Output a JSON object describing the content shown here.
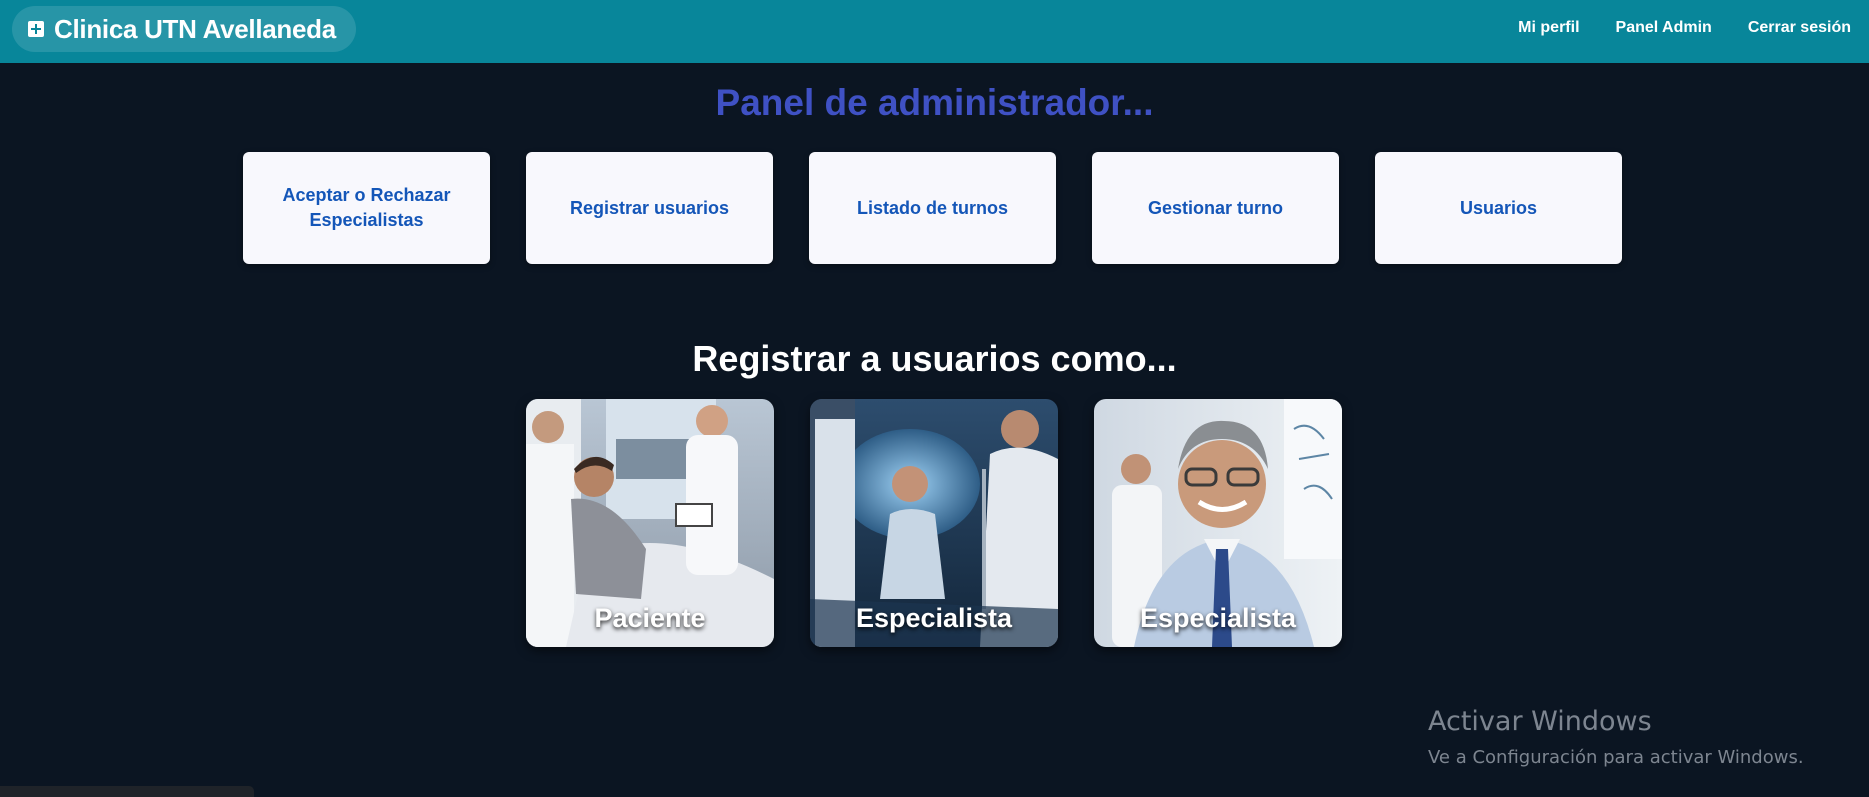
{
  "navbar": {
    "brand": "Clinica UTN Avellaneda",
    "brand_icon": "plus-square-icon",
    "links": [
      "Mi perfil",
      "Panel Admin",
      "Cerrar sesión"
    ]
  },
  "admin": {
    "title": "Panel de administrador...",
    "cards": [
      "Aceptar o Rechazar Especialistas",
      "Registrar usuarios",
      "Listado de turnos",
      "Gestionar turno",
      "Usuarios"
    ]
  },
  "register": {
    "title": "Registrar a usuarios como...",
    "tiles": [
      "Paciente",
      "Especialista",
      "Especialista"
    ]
  },
  "watermark": {
    "title": "Activar Windows",
    "subtitle": "Ve a Configuración para activar Windows."
  },
  "colors": {
    "navbar": "#08869a",
    "background": "#0b1522",
    "admin_title": "#3f51c4",
    "card_text": "#1456b8"
  }
}
